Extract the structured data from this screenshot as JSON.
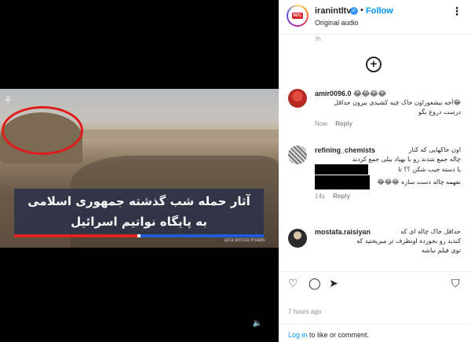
{
  "post": {
    "account": "iranintltv",
    "follow_label": "Follow",
    "audio_label": "Original audio",
    "brand_badge": "INTL",
    "more_icon": "⋮"
  },
  "video": {
    "caption_line1": "آثار حمله شب گذشته جمهوری اسلامی",
    "caption_line2": "به پایگاه نواتیم اسرائیل",
    "credit": "מסגרת נבכחים בהם",
    "bar_colors": [
      "#e02424",
      "#ffffff",
      "#1e5bd6"
    ]
  },
  "comments": {
    "partial_time": "7h",
    "items": [
      {
        "user": "amir0096.0",
        "emoji": "😂😂😂😂",
        "text": "😂آخه بیشعوراون خاک چیه کشیدی بیرون حداقل درست دروغ بگو",
        "time": "Now",
        "reply": "Reply"
      },
      {
        "user": "refining_chemists",
        "text_line1": "اون خاکهایی که کنار",
        "text_line2": "چاله جمع شدند رو با بهپاد بیلی جمع کردند",
        "text_line3": "یا دسته جیب شکن ؟؟ تا",
        "text_line4": "نفهمه چاله دست سازه 😂😂😂",
        "time": "14s",
        "reply": "Reply"
      },
      {
        "user": "mostafa.raisiyan",
        "text_line1": "حداقل خاک چاله ای که",
        "text_line2": "کندید رو بخورده اونطرف تر میریختید که",
        "text_line3": "توی فیلم نباشه"
      }
    ]
  },
  "footer": {
    "posted_time": "7 hours ago",
    "login_link": "Log in",
    "login_rest": " to like or comment."
  }
}
